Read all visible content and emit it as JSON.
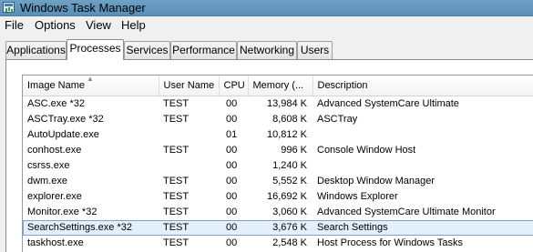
{
  "window": {
    "title": "Windows Task Manager"
  },
  "menu": {
    "file": "File",
    "options": "Options",
    "view": "View",
    "help": "Help"
  },
  "tabs": [
    {
      "label": "Applications"
    },
    {
      "label": "Processes"
    },
    {
      "label": "Services"
    },
    {
      "label": "Performance"
    },
    {
      "label": "Networking"
    },
    {
      "label": "Users"
    }
  ],
  "active_tab": "Processes",
  "table": {
    "columns": {
      "image_name": "Image Name",
      "user_name": "User Name",
      "cpu": "CPU",
      "memory": "Memory (...",
      "description": "Description"
    },
    "sort_column": "Image Name",
    "rows": [
      {
        "image": "ASC.exe *32",
        "user": "TEST",
        "cpu": "00",
        "memory": "13,984 K",
        "desc": "Advanced SystemCare Ultimate"
      },
      {
        "image": "ASCTray.exe *32",
        "user": "TEST",
        "cpu": "00",
        "memory": "8,608 K",
        "desc": "ASCTray"
      },
      {
        "image": "AutoUpdate.exe",
        "user": "",
        "cpu": "01",
        "memory": "10,812 K",
        "desc": ""
      },
      {
        "image": "conhost.exe",
        "user": "TEST",
        "cpu": "00",
        "memory": "996 K",
        "desc": "Console Window Host"
      },
      {
        "image": "csrss.exe",
        "user": "",
        "cpu": "00",
        "memory": "1,240 K",
        "desc": ""
      },
      {
        "image": "dwm.exe",
        "user": "TEST",
        "cpu": "00",
        "memory": "5,552 K",
        "desc": "Desktop Window Manager"
      },
      {
        "image": "explorer.exe",
        "user": "TEST",
        "cpu": "00",
        "memory": "16,692 K",
        "desc": "Windows Explorer"
      },
      {
        "image": "Monitor.exe *32",
        "user": "TEST",
        "cpu": "00",
        "memory": "3,060 K",
        "desc": "Advanced SystemCare Ultimate Monitor"
      },
      {
        "image": "SearchSettings.exe *32",
        "user": "TEST",
        "cpu": "00",
        "memory": "3,676 K",
        "desc": "Search Settings"
      },
      {
        "image": "taskhost.exe",
        "user": "TEST",
        "cpu": "00",
        "memory": "2,548 K",
        "desc": "Host Process for Windows Tasks"
      }
    ],
    "selected_image": "SearchSettings.exe *32"
  }
}
